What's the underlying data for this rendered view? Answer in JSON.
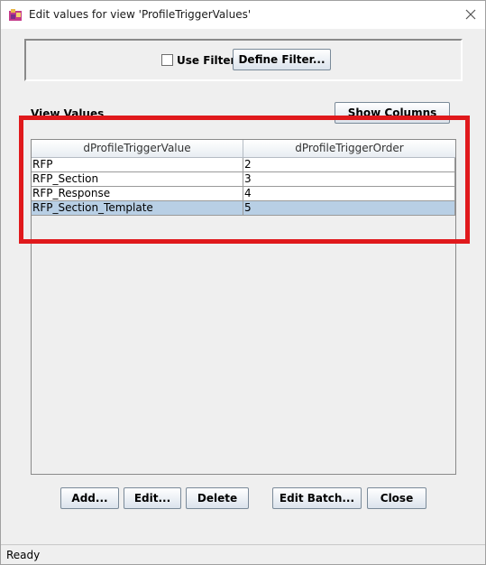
{
  "window": {
    "title": "Edit values for view 'ProfileTriggerValues'"
  },
  "filter": {
    "use_filter_label": "Use Filter",
    "use_filter_checked": false,
    "define_filter_label": "Define Filter..."
  },
  "view_values": {
    "label": "View Values",
    "show_columns_label": "Show Columns"
  },
  "table": {
    "columns": [
      "dProfileTriggerValue",
      "dProfileTriggerOrder"
    ],
    "rows": [
      {
        "value": "RFP",
        "order": "2"
      },
      {
        "value": "RFP_Section",
        "order": "3"
      },
      {
        "value": "RFP_Response",
        "order": "4"
      },
      {
        "value": "RFP_Section_Template",
        "order": "5"
      }
    ],
    "selected_row_index": 3
  },
  "actions": {
    "add_label": "Add...",
    "edit_label": "Edit...",
    "delete_label": "Delete",
    "edit_batch_label": "Edit Batch...",
    "close_label": "Close"
  },
  "status": {
    "text": "Ready"
  },
  "colors": {
    "highlight": "#e0191c",
    "selection": "#b8cfe5"
  }
}
